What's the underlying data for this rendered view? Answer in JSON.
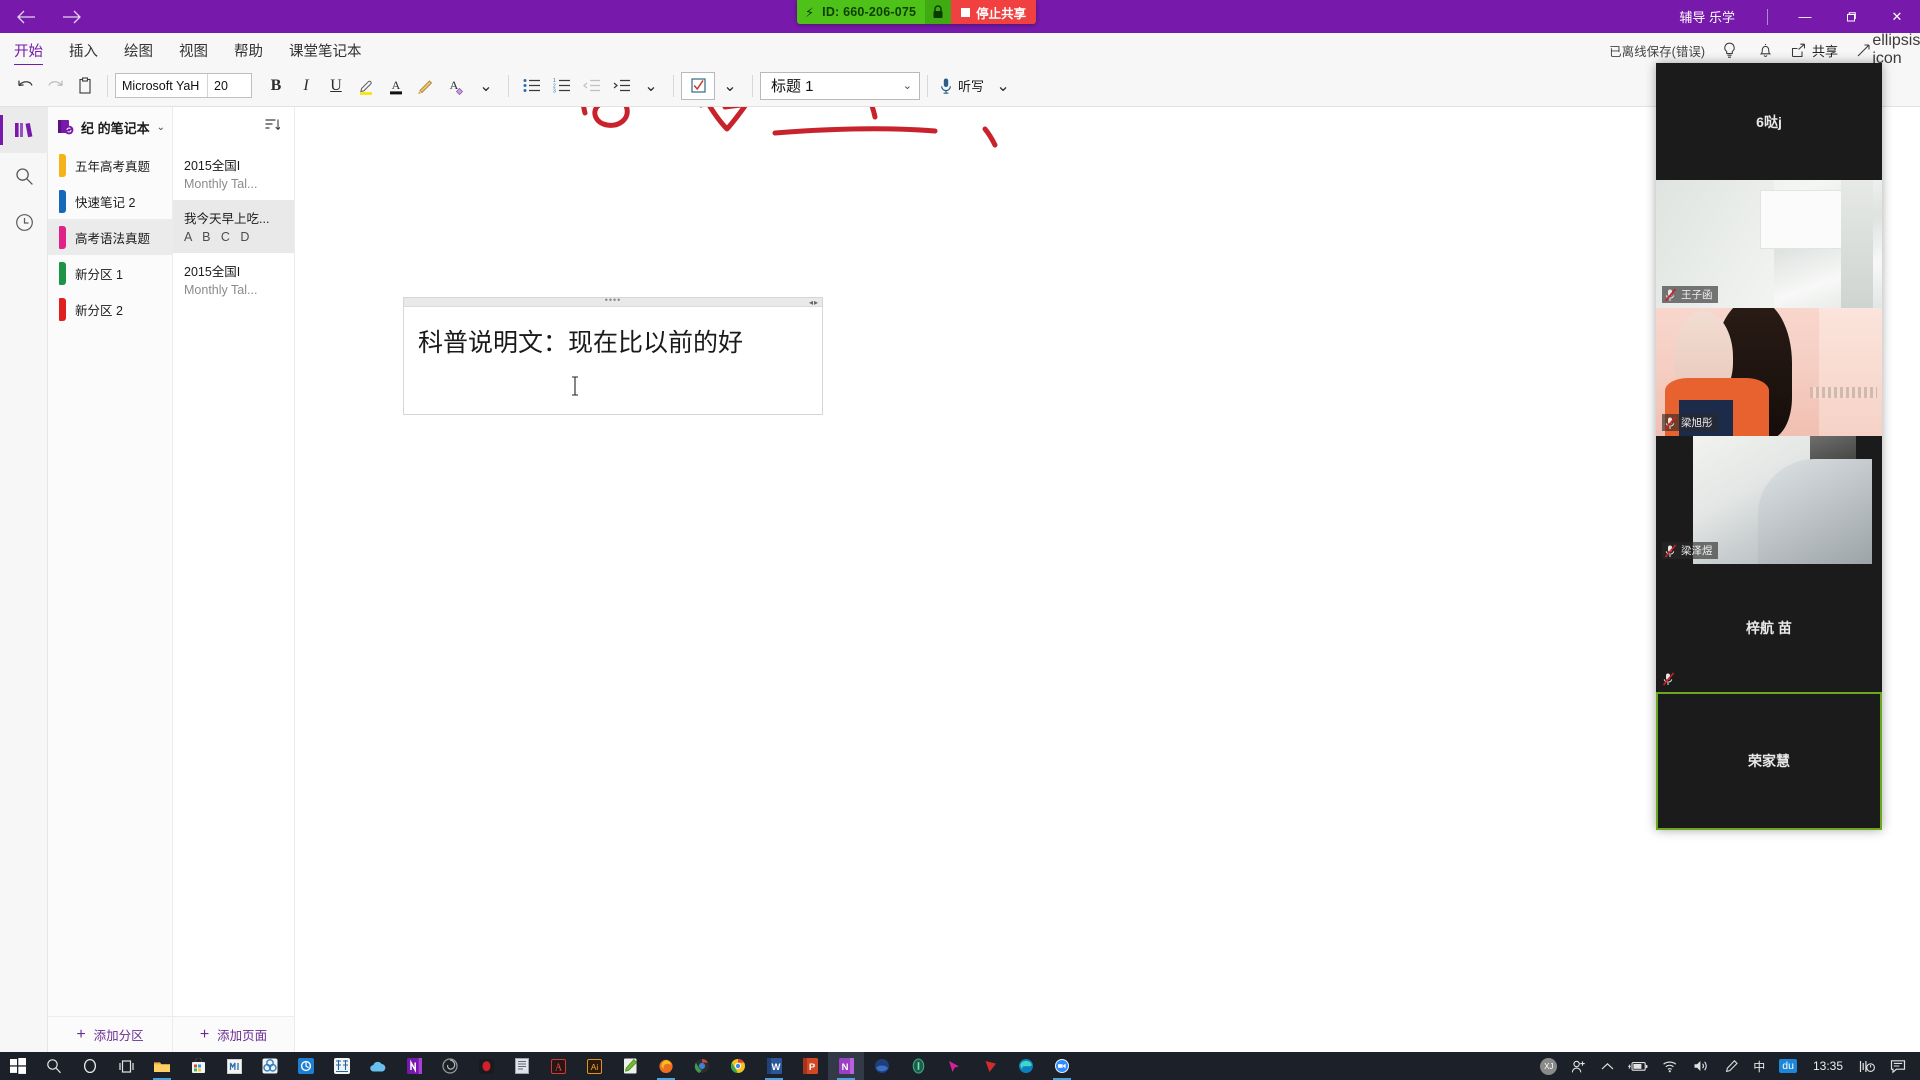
{
  "titlebar": {
    "back_icon": "arrow-left-icon",
    "forward_icon": "arrow-right-icon",
    "account": "辅导 乐学",
    "minimize": "—",
    "maximize": "❐",
    "close": "✕"
  },
  "sharebar": {
    "bolt_icon": "lightning-icon",
    "meeting_id": "ID: 660-206-075",
    "lock_icon": "lock-icon",
    "stop_label": "停止共享"
  },
  "ribbon": {
    "tabs": [
      {
        "label": "开始",
        "active": true
      },
      {
        "label": "插入",
        "active": false
      },
      {
        "label": "绘图",
        "active": false
      },
      {
        "label": "视图",
        "active": false
      },
      {
        "label": "帮助",
        "active": false
      },
      {
        "label": "课堂笔记本",
        "active": false
      }
    ],
    "save_status": "已离线保存(错误)",
    "ideas_icon": "lightbulb-icon",
    "notifications_icon": "bell-icon",
    "share_icon": "share-icon",
    "share_label": "共享",
    "expand_icon": "expand-arrow-icon",
    "more_icon": "ellipsis-icon"
  },
  "toolbar": {
    "undo_icon": "undo-icon",
    "redo_icon": "redo-icon",
    "clipboard_icon": "clipboard-icon",
    "font_name": "Microsoft YaH",
    "font_size": "20",
    "bold": "B",
    "italic": "I",
    "underline": "U",
    "highlight_icon": "highlighter-icon",
    "font_color_icon": "font-color-icon",
    "format_painter_icon": "format-painter-icon",
    "clear_format_icon": "clear-formatting-icon",
    "more_font_caret": "⌄",
    "bullet_list_icon": "bullet-list-icon",
    "numbered_list_icon": "numbered-list-icon",
    "outdent_icon": "decrease-indent-icon",
    "indent_icon": "increase-indent-icon",
    "paragraph_caret": "⌄",
    "todo_icon": "checkbox-tag-icon",
    "todo_caret": "⌄",
    "style_value": "标题 1",
    "style_caret": "⌄",
    "dictate_icon": "microphone-icon",
    "dictate_label": "听写",
    "dictate_caret": "⌄"
  },
  "rail": {
    "items": [
      {
        "name": "notebooks",
        "icon": "notebooks-icon",
        "active": true
      },
      {
        "name": "search",
        "icon": "search-icon",
        "active": false
      },
      {
        "name": "recent",
        "icon": "clock-icon",
        "active": false
      }
    ]
  },
  "notebook": {
    "icon": "notebook-sync-icon",
    "title": "纪 的笔记本",
    "caret": "⌄",
    "sections": [
      {
        "label": "五年高考真题",
        "color": "#f2b419",
        "active": false
      },
      {
        "label": "快速笔记 2",
        "color": "#1668b8",
        "active": false
      },
      {
        "label": "高考语法真题",
        "color": "#e0218a",
        "active": true
      },
      {
        "label": "新分区 1",
        "color": "#1e9245",
        "active": false
      },
      {
        "label": "新分区 2",
        "color": "#e02020",
        "active": false
      }
    ],
    "add_section_plus": "+",
    "add_section_label": "添加分区"
  },
  "pages": {
    "sort_icon": "sort-icon",
    "items": [
      {
        "title": "2015全国I",
        "sub": "Monthly Tal...",
        "sub_is_letters": false,
        "active": false
      },
      {
        "title": "我今天早上吃...",
        "sub": "A  B  C  D",
        "sub_is_letters": true,
        "active": true
      },
      {
        "title": "2015全国I",
        "sub": "Monthly Tal...",
        "sub_is_letters": false,
        "active": false
      }
    ],
    "add_page_plus": "+",
    "add_page_label": "添加页面"
  },
  "canvas": {
    "ink_color": "#c8232c",
    "note_text": "科普说明文：现在比以前的好",
    "handle_dots": "••••",
    "resize_arrows": "◂▸",
    "cursor_icon": "text-cursor-icon"
  },
  "video_panel": {
    "tiles": [
      {
        "name": "6哒j",
        "layout": "center",
        "has_video": false,
        "muted": false,
        "active": false
      },
      {
        "name": "王子函",
        "layout": "corner",
        "has_video": true,
        "video_style": "room",
        "muted": true,
        "active": false
      },
      {
        "name": "梁旭彤",
        "layout": "corner",
        "has_video": true,
        "video_style": "person",
        "muted": true,
        "active": false
      },
      {
        "name": "梁泽煜",
        "layout": "corner",
        "has_video": true,
        "video_style": "blanket",
        "muted": true,
        "active": false
      },
      {
        "name": "梓航 苗",
        "layout": "center",
        "has_video": false,
        "muted": true,
        "active": false
      },
      {
        "name": "荣家慧",
        "layout": "center",
        "has_video": false,
        "muted": false,
        "active": true
      }
    ],
    "active_border_color": "#6aa81e",
    "mic_mute_icon": "microphone-muted-icon"
  },
  "taskbar": {
    "apps": [
      {
        "name": "start-button",
        "icon": "windows-logo-icon"
      },
      {
        "name": "search-button",
        "icon": "search-icon"
      },
      {
        "name": "cortana-button",
        "icon": "circle-icon"
      },
      {
        "name": "task-view-button",
        "icon": "task-view-icon"
      },
      {
        "name": "file-explorer",
        "icon": "folder-icon"
      },
      {
        "name": "microsoft-store",
        "icon": "store-icon"
      },
      {
        "name": "app-m",
        "icon": "m-app-icon"
      },
      {
        "name": "app-rings",
        "icon": "rings-app-icon"
      },
      {
        "name": "app-blue-circle",
        "icon": "blue-circle-app-icon"
      },
      {
        "name": "app-dict",
        "icon": "dictionary-app-icon"
      },
      {
        "name": "onedrive",
        "icon": "cloud-icon"
      },
      {
        "name": "onenote-n",
        "icon": "onenote-icon"
      },
      {
        "name": "app-spiral",
        "icon": "spiral-app-icon"
      },
      {
        "name": "app-dark-red",
        "icon": "dark-red-app-icon"
      },
      {
        "name": "notepad",
        "icon": "notepad-icon"
      },
      {
        "name": "adobe-acrobat",
        "icon": "acrobat-icon"
      },
      {
        "name": "adobe-illustrator",
        "icon": "illustrator-icon"
      },
      {
        "name": "app-note-green",
        "icon": "green-note-icon"
      },
      {
        "name": "firefox",
        "icon": "firefox-icon"
      },
      {
        "name": "chrome-dark",
        "icon": "chrome-dark-icon"
      },
      {
        "name": "google-chrome",
        "icon": "chrome-icon"
      },
      {
        "name": "microsoft-word",
        "icon": "word-icon"
      },
      {
        "name": "powerpoint",
        "icon": "powerpoint-icon"
      },
      {
        "name": "onenote-purple",
        "icon": "onenote-purple-icon"
      },
      {
        "name": "app-moon",
        "icon": "moon-app-icon"
      },
      {
        "name": "app-capsule",
        "icon": "capsule-app-icon"
      },
      {
        "name": "app-magenta-cursor",
        "icon": "magenta-cursor-icon"
      },
      {
        "name": "app-red-play",
        "icon": "red-play-icon"
      },
      {
        "name": "microsoft-edge",
        "icon": "edge-icon"
      },
      {
        "name": "zoom-meeting",
        "icon": "video-camera-icon"
      }
    ],
    "tray": {
      "avatar_initials": "XJ",
      "people_icon": "people-icon",
      "chevron_up_icon": "chevron-up-icon",
      "battery_icon": "battery-icon",
      "wifi_icon": "wifi-icon",
      "volume_icon": "volume-icon",
      "pen_icon": "pen-icon",
      "ime_mode": "中",
      "ime_badge": "du",
      "clock": "13:35",
      "meter_icon": "meter-icon",
      "action_center_icon": "action-center-icon"
    }
  }
}
